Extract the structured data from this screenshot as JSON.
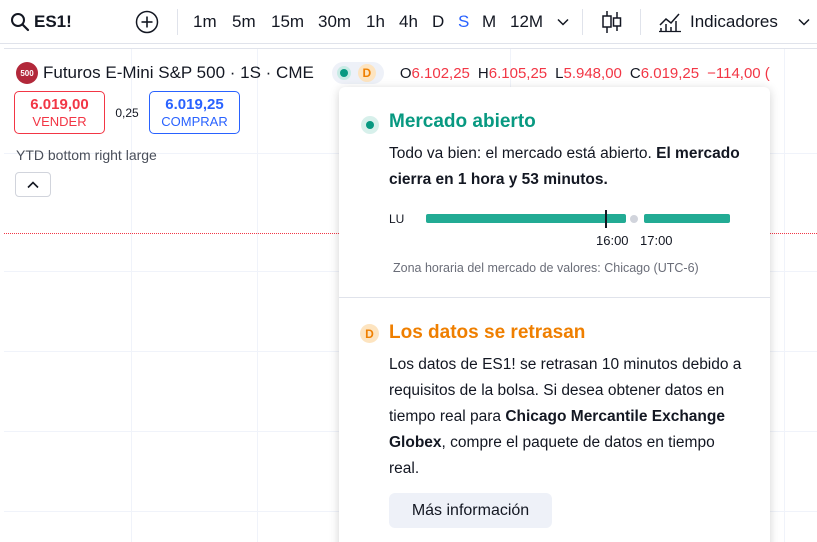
{
  "toolbar": {
    "symbol": "ES1!",
    "timeframes": [
      "1m",
      "5m",
      "15m",
      "30m",
      "1h",
      "4h",
      "D",
      "S",
      "M",
      "12M"
    ],
    "active_timeframe": "S",
    "indicators_label": "Indicadores"
  },
  "legend": {
    "exchange_badge": "500",
    "title": "Futuros E-Mini S&P 500 · 1S · CME",
    "status_badge": "D",
    "open_key": "O",
    "open": "6.102,25",
    "high_key": "H",
    "high": "6.105,25",
    "low_key": "L",
    "low": "5.948,00",
    "close_key": "C",
    "close": "6.019,25",
    "change": "−114,00 ("
  },
  "trade": {
    "sell_price": "6.019,00",
    "sell_label": "VENDER",
    "spread": "0,25",
    "buy_price": "6.019,25",
    "buy_label": "COMPRAR"
  },
  "indicator_line": "YTD bottom right large",
  "popover": {
    "market": {
      "title": "Mercado abierto",
      "text": "Todo va bien: el mercado está abierto.",
      "text_bold": "El mercado cierra en 1 hora y 53 minutos.",
      "day_label": "LU",
      "time1": "16:00",
      "time2": "17:00",
      "timezone": "Zona horaria del mercado de valores: Chicago (UTC-6)"
    },
    "delay": {
      "badge": "D",
      "title": "Los datos se retrasan",
      "text1": "Los datos de ES1! se retrasan 10 minutos debido a requisitos de la bolsa. Si desea obtener datos en tiempo real para",
      "text_bold": "Chicago Mercantile Exchange Globex",
      "text2": ", compre el paquete de datos en tiempo real.",
      "button": "Más información"
    }
  },
  "colors": {
    "accent": "#2962ff",
    "down": "#f23645",
    "market_open": "#089981",
    "delayed": "#ef7f00"
  }
}
